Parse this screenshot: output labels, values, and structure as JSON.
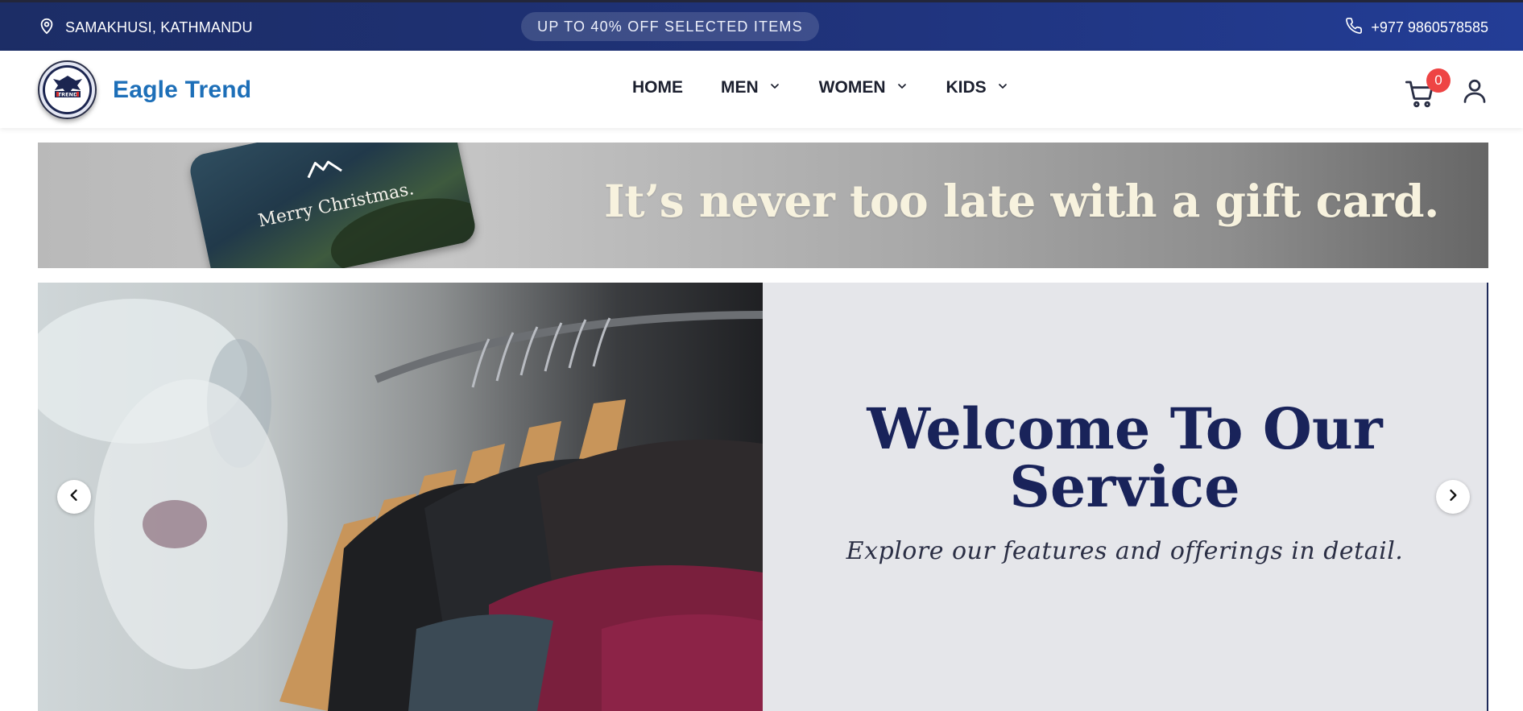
{
  "topbar": {
    "location": "SAMAKHUSI, KATHMANDU",
    "promo": "UP TO 40% OFF SELECTED ITEMS",
    "phone": "+977 9860578585",
    "location_icon": "map-pin-icon",
    "phone_icon": "phone-icon"
  },
  "navbar": {
    "brand": "Eagle Trend",
    "logo_text": "TREND",
    "menu": [
      {
        "label": "HOME",
        "has_dropdown": false
      },
      {
        "label": "MEN",
        "has_dropdown": true
      },
      {
        "label": "WOMEN",
        "has_dropdown": true
      },
      {
        "label": "KIDS",
        "has_dropdown": true
      }
    ],
    "cart_count": "0",
    "cart_icon": "cart-icon",
    "user_icon": "user-icon"
  },
  "gift_banner": {
    "card_text": "Merry Christmas.",
    "headline": "It’s never too late with a gift card."
  },
  "hero": {
    "title_line1": "Welcome To Our",
    "title_line2": "Service",
    "subtitle": "Explore our features and offerings in detail.",
    "prev_icon": "chevron-left-icon",
    "next_icon": "chevron-right-icon"
  },
  "colors": {
    "topbar": "#1f3278",
    "brand": "#1d6fb8",
    "hero_title": "#19235a",
    "hero_panel": "#e5e6ea",
    "badge": "#ee4444"
  }
}
